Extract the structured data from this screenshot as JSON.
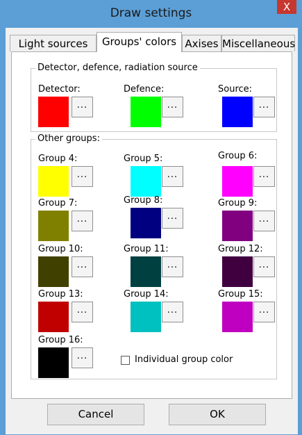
{
  "window": {
    "title": "Draw settings",
    "close_glyph": "X"
  },
  "tabs": [
    {
      "label": "Light sources"
    },
    {
      "label": "Groups' colors"
    },
    {
      "label": "Axises"
    },
    {
      "label": "Miscellaneous"
    }
  ],
  "active_tab": 1,
  "detector_group": {
    "title": "Detector, defence, radiation source",
    "items": [
      {
        "label": "Detector:",
        "color": "#ff0000",
        "button": "..."
      },
      {
        "label": "Defence:",
        "color": "#00ff00",
        "button": "..."
      },
      {
        "label": "Source:",
        "color": "#0000ff",
        "button": "..."
      }
    ]
  },
  "other_groups": {
    "title": "Other groups:",
    "items": [
      {
        "label": "Group 4:",
        "color": "#ffff00",
        "button": "..."
      },
      {
        "label": "Group 5:",
        "color": "#00ffff",
        "button": "..."
      },
      {
        "label": "Group 6:",
        "color": "#ff00ff",
        "button": "..."
      },
      {
        "label": "Group 7:",
        "color": "#808000",
        "button": "..."
      },
      {
        "label": "Group 8:",
        "color": "#000080",
        "button": "..."
      },
      {
        "label": "Group 9:",
        "color": "#800080",
        "button": "..."
      },
      {
        "label": "Group 10:",
        "color": "#404000",
        "button": "..."
      },
      {
        "label": "Group 11:",
        "color": "#004040",
        "button": "..."
      },
      {
        "label": "Group 12:",
        "color": "#400040",
        "button": "..."
      },
      {
        "label": "Group 13:",
        "color": "#c00000",
        "button": "..."
      },
      {
        "label": "Group 14:",
        "color": "#00c0c0",
        "button": "..."
      },
      {
        "label": "Group 15:",
        "color": "#c000c0",
        "button": "..."
      },
      {
        "label": "Group 16:",
        "color": "#000000",
        "button": "..."
      }
    ],
    "individual_checkbox": {
      "label": "Individual group color",
      "checked": false
    }
  },
  "buttons": {
    "cancel": "Cancel",
    "ok": "OK"
  }
}
